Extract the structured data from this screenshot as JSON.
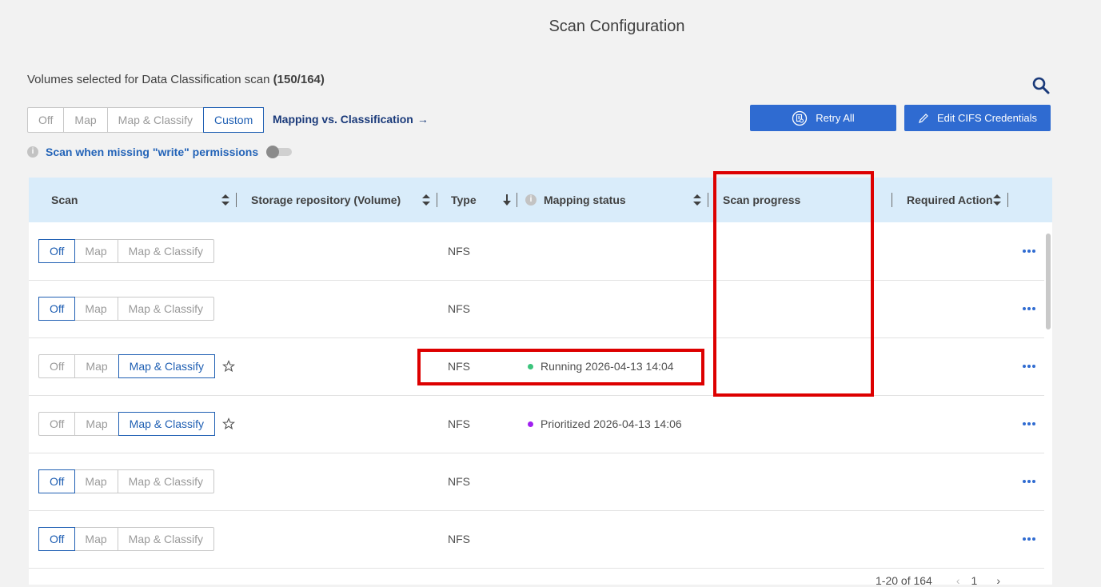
{
  "header": {
    "title": "Scan Configuration",
    "subtitle_prefix": "Volumes selected for Data Classification scan ",
    "subtitle_count": "(150/164)"
  },
  "scan_mode": {
    "options": [
      "Off",
      "Map",
      "Map & Classify",
      "Custom"
    ],
    "selected": "Custom"
  },
  "links": {
    "mapping_vs_classification": "Mapping vs. Classification"
  },
  "buttons": {
    "retry_all": "Retry All",
    "edit_cifs": "Edit CIFS Credentials"
  },
  "permissions": {
    "label": "Scan when missing \"write\" permissions",
    "enabled": false
  },
  "table": {
    "columns": {
      "scan": "Scan",
      "storage": "Storage repository (Volume)",
      "type": "Type",
      "mapping": "Mapping status",
      "progress": "Scan progress",
      "action": "Required Action"
    },
    "row_options": [
      "Off",
      "Map",
      "Map & Classify"
    ],
    "rows": [
      {
        "scan": "Off",
        "type": "NFS",
        "status": "",
        "status_color": ""
      },
      {
        "scan": "Off",
        "type": "NFS",
        "status": "",
        "status_color": ""
      },
      {
        "scan": "Map & Classify",
        "type": "NFS",
        "status": "Running 2026-04-13 14:04",
        "status_color": "#3cc47c"
      },
      {
        "scan": "Map & Classify",
        "type": "NFS",
        "status": "Prioritized 2026-04-13 14:06",
        "status_color": "#a020f0"
      },
      {
        "scan": "Off",
        "type": "NFS",
        "status": "",
        "status_color": ""
      },
      {
        "scan": "Off",
        "type": "NFS",
        "status": "",
        "status_color": ""
      }
    ]
  },
  "pagination": {
    "range": "1-20 of 164",
    "page": "1"
  },
  "colors": {
    "accent": "#2f6bd1",
    "header_bg": "#d9ecfa",
    "highlight": "#dd0000"
  }
}
